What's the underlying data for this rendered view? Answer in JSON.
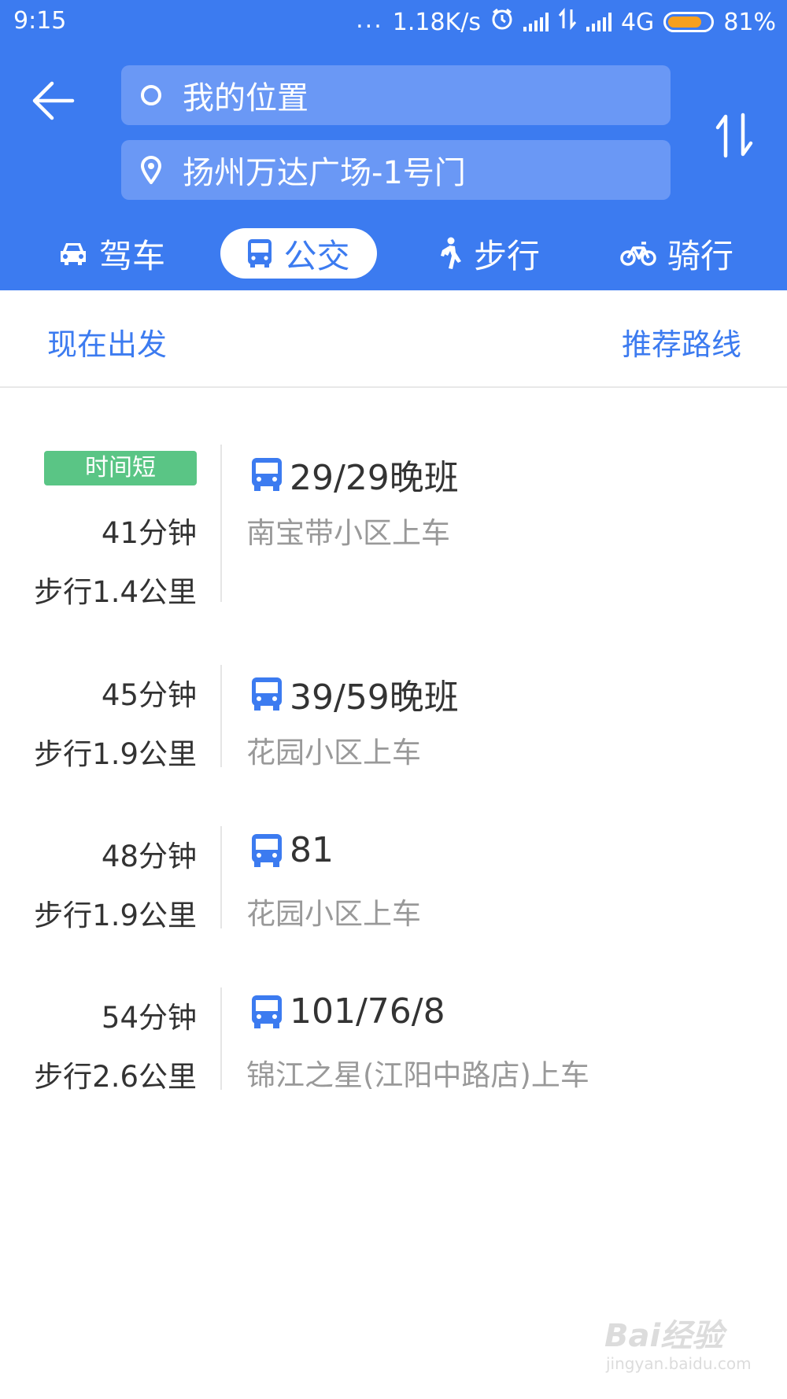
{
  "status_bar": {
    "time": "9:15",
    "dots": "...",
    "speed": "1.18K/s",
    "network": "4G",
    "battery": "81%",
    "battery_level": 0.81
  },
  "header": {
    "origin": "我的位置",
    "destination": "扬州万达广场-1号门"
  },
  "tabs": [
    {
      "label": "驾车",
      "icon": "car-icon"
    },
    {
      "label": "公交",
      "icon": "bus-icon",
      "active": true
    },
    {
      "label": "步行",
      "icon": "walk-icon"
    },
    {
      "label": "骑行",
      "icon": "bike-icon"
    }
  ],
  "options": {
    "depart": "现在出发",
    "sort": "推荐路线"
  },
  "routes": [
    {
      "badge": "时间短",
      "duration": "41分钟",
      "walk": "步行1.4公里",
      "line": "29/29晚班",
      "stop": "南宝带小区上车"
    },
    {
      "duration": "45分钟",
      "walk": "步行1.9公里",
      "line": "39/59晚班",
      "stop": "花园小区上车"
    },
    {
      "duration": "48分钟",
      "walk": "步行1.9公里",
      "line": "81",
      "stop": "花园小区上车"
    },
    {
      "duration": "54分钟",
      "walk": "步行2.6公里",
      "line": "101/76/8",
      "stop": "锦江之星(江阳中路店)上车"
    }
  ],
  "watermark": {
    "text": "Bai经验",
    "url": "jingyan.baidu.com"
  },
  "colors": {
    "primary": "#3c7bf0",
    "field": "#6a98f5",
    "badge": "#5ac585",
    "battery_fill": "#f7a01e"
  }
}
